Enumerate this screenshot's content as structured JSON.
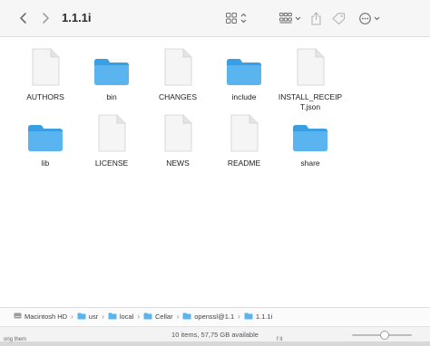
{
  "window": {
    "title": "1.1.1i"
  },
  "toolbar": {
    "back_icon": "chevron-left-icon",
    "forward_icon": "chevron-right-icon",
    "view_icon": "grid-view-icon",
    "group_icon": "group-by-icon",
    "share_icon": "share-icon",
    "tag_icon": "tag-icon",
    "more_icon": "ellipsis-circle-icon"
  },
  "items": [
    {
      "label": "AUTHORS",
      "kind": "file"
    },
    {
      "label": "bin",
      "kind": "folder"
    },
    {
      "label": "CHANGES",
      "kind": "file"
    },
    {
      "label": "include",
      "kind": "folder"
    },
    {
      "label": "INSTALL_RECEIPT.json",
      "kind": "file"
    },
    {
      "label": "lib",
      "kind": "folder"
    },
    {
      "label": "LICENSE",
      "kind": "file"
    },
    {
      "label": "NEWS",
      "kind": "file"
    },
    {
      "label": "README",
      "kind": "file"
    },
    {
      "label": "share",
      "kind": "folder"
    }
  ],
  "pathbar": {
    "crumbs": [
      "Macintosh HD",
      "usr",
      "local",
      "Cellar",
      "openssl@1.1",
      "1.1.1i"
    ]
  },
  "status": {
    "text": "10 items, 57,75 GB available",
    "icon_size_level": 0.55
  },
  "background": {
    "left_text": "ong them",
    "right_text": "f it"
  },
  "colors": {
    "folder": "#5ab4ef",
    "folder_tab": "#3a9fe2",
    "file": "#f5f5f5"
  }
}
